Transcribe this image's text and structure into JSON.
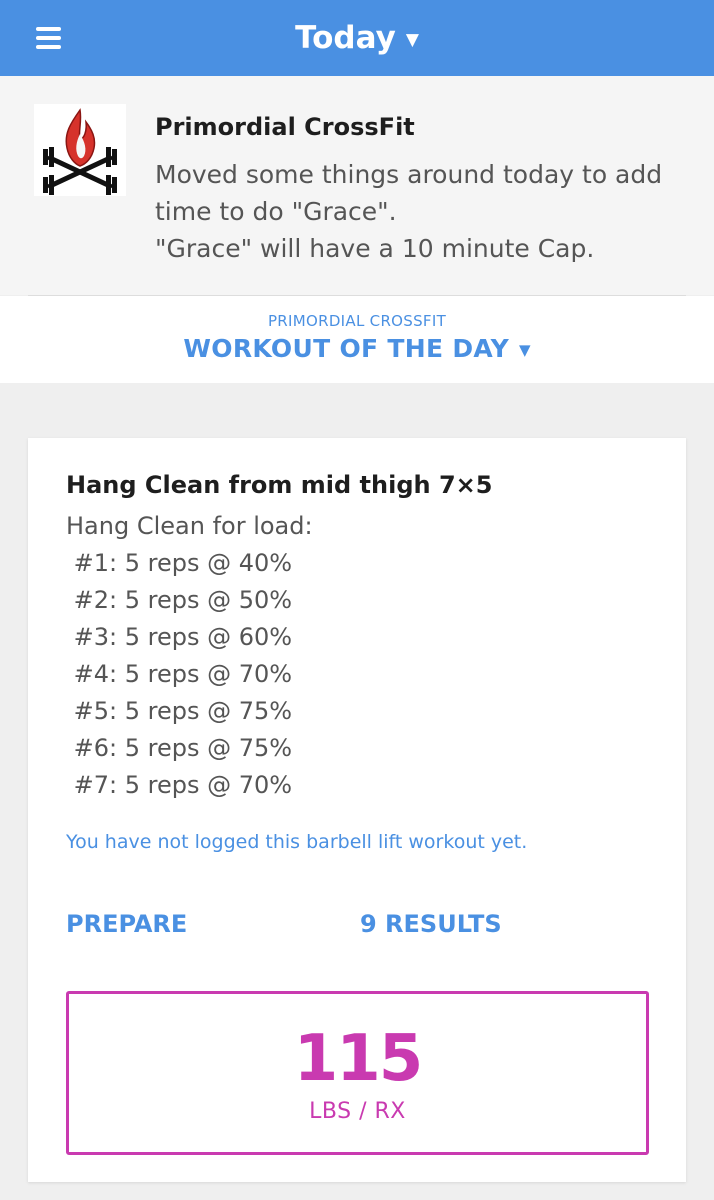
{
  "header": {
    "title": "Today",
    "menu_icon": "hamburger-menu-icon",
    "dropdown_icon": "caret-down-icon"
  },
  "announcement": {
    "gym_name": "Primordial CrossFit",
    "logo_icon": "flame-crossed-barbells-logo",
    "message": "Moved some things around today to add time to do \"Grace\".\n\"Grace\" will have a 10 minute Cap."
  },
  "section": {
    "subtitle": "PRIMORDIAL CROSSFIT",
    "title": "WORKOUT OF THE DAY"
  },
  "workout": {
    "title": "Hang Clean from mid thigh 7×5",
    "lines": [
      "Hang Clean for load:",
      " #1: 5 reps @ 40%",
      " #2: 5 reps @ 50%",
      " #3: 5 reps @ 60%",
      " #4: 5 reps @ 70%",
      " #5: 5 reps @ 75%",
      " #6: 5 reps @ 75%",
      " #7: 5 reps @ 70%"
    ],
    "log_note": "You have not logged this barbell lift workout yet.",
    "prepare_label": "PREPARE",
    "results_label": "9 RESULTS"
  },
  "score": {
    "value": "115",
    "unit": "LBS / RX"
  },
  "colors": {
    "header_blue": "#4a90e2",
    "accent_magenta": "#c93ab0",
    "logo_red": "#d6322b"
  }
}
